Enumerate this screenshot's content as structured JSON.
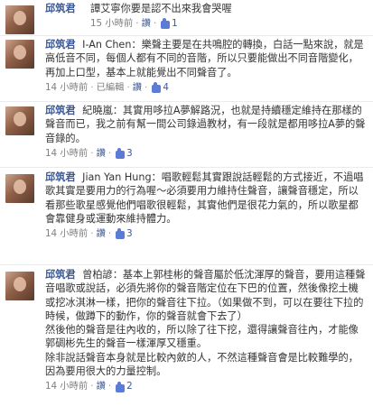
{
  "comments": [
    {
      "author": "邱筑君",
      "text": "譚艾寧你要是認不出來我會哭喔",
      "time": "15 小時前",
      "like": "讚",
      "count": "1",
      "edited": ""
    },
    {
      "author": "邱筑君",
      "text": "I-An Chen：樂聲主要是在共鳴腔的轉換，白話一點來說，就是高低音不同，每個人都有不同的音階，所以只要能做出不同音階變化，再加上口型，基本上就能覺出不同聲音了。",
      "time": "14 小時前",
      "like": "讚",
      "count": "4",
      "edited": "已編輯"
    },
    {
      "author": "邱筑君",
      "text": "紀曉嵐：其實用哆拉A夢解路況，也就是持續穩定維持在那樣的聲音而已，我之前有幫一間公司錄過教材，有一段就是都用哆拉A夢的聲音錄的。",
      "time": "14 小時前",
      "like": "讚",
      "count": "3",
      "edited": ""
    },
    {
      "author": "邱筑君",
      "text": "Jian Yan Hung：唱歌輕鬆其實跟說話輕鬆的方式接近，不過唱歌其實是要用力的行為喔～必須要用力維持住聲音，讓聲音穩定，所以看那些歌星感覺他們唱歌很輕鬆，其實他們是很花力氣的，所以歌星都會靠健身或運動來維持體力。",
      "time": "14 小時前",
      "like": "讚",
      "count": "3",
      "edited": ""
    },
    {
      "author": "邱筑君",
      "text": "曾柏諺：基本上郭桂彬的聲音屬於低沈渾厚的聲音，要用這種聲音唱歌或說話，必須先將你的聲音階定位在下巴的位置，然後像挖土機或挖冰淇淋一樣，把你的聲音往下拉。（如果做不到，可以在要往下拉的時候，做蹲下的動作，你的聲音就會下去了）\n然後他的聲音是往內收的，所以除了往下挖，還得讓聲音往內，才能像郭碉彬先生的聲音一樣渾厚又穩重。\n除非說話聲音本身就是比較內斂的人，不然這種聲音會是比較難學的，因為要用很大的力量控制。",
      "time": "14 小時前",
      "like": "讚",
      "count": "2",
      "edited": ""
    }
  ]
}
